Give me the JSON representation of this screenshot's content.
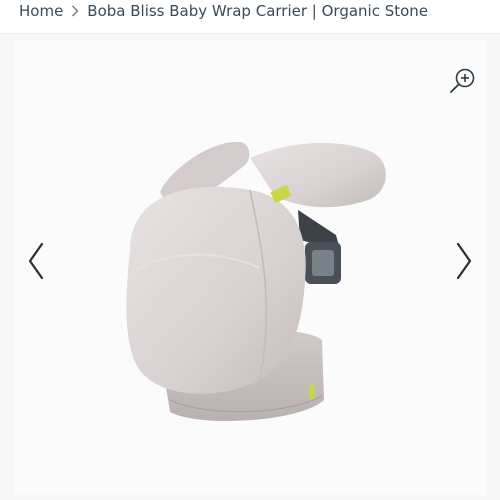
{
  "breadcrumb": {
    "home": "Home",
    "separator_icon": "chevron-right-icon",
    "current": "Boba Bliss Baby Wrap Carrier | Organic Stone"
  },
  "gallery": {
    "zoom_icon": "zoom-in-icon",
    "prev_icon": "chevron-left-icon",
    "next_icon": "chevron-right-icon",
    "product_image": "baby-wrap-carrier-image",
    "product_color": "#ddd6d6"
  }
}
